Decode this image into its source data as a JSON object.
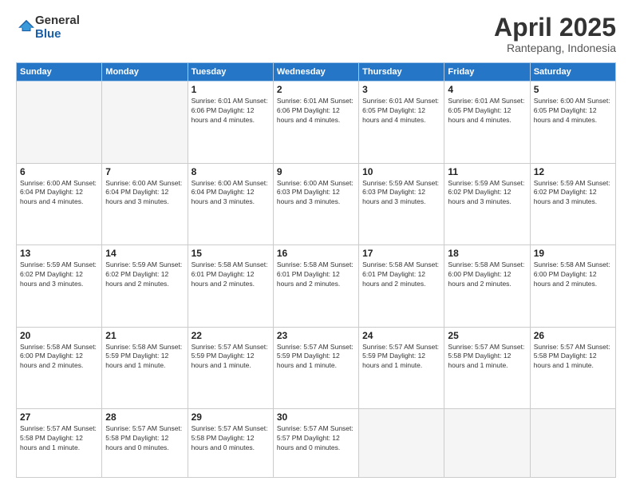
{
  "logo": {
    "general": "General",
    "blue": "Blue"
  },
  "title": {
    "month": "April 2025",
    "location": "Rantepang, Indonesia"
  },
  "days_of_week": [
    "Sunday",
    "Monday",
    "Tuesday",
    "Wednesday",
    "Thursday",
    "Friday",
    "Saturday"
  ],
  "weeks": [
    [
      {
        "day": "",
        "detail": ""
      },
      {
        "day": "",
        "detail": ""
      },
      {
        "day": "1",
        "detail": "Sunrise: 6:01 AM\nSunset: 6:06 PM\nDaylight: 12 hours and 4 minutes."
      },
      {
        "day": "2",
        "detail": "Sunrise: 6:01 AM\nSunset: 6:06 PM\nDaylight: 12 hours and 4 minutes."
      },
      {
        "day": "3",
        "detail": "Sunrise: 6:01 AM\nSunset: 6:05 PM\nDaylight: 12 hours and 4 minutes."
      },
      {
        "day": "4",
        "detail": "Sunrise: 6:01 AM\nSunset: 6:05 PM\nDaylight: 12 hours and 4 minutes."
      },
      {
        "day": "5",
        "detail": "Sunrise: 6:00 AM\nSunset: 6:05 PM\nDaylight: 12 hours and 4 minutes."
      }
    ],
    [
      {
        "day": "6",
        "detail": "Sunrise: 6:00 AM\nSunset: 6:04 PM\nDaylight: 12 hours and 4 minutes."
      },
      {
        "day": "7",
        "detail": "Sunrise: 6:00 AM\nSunset: 6:04 PM\nDaylight: 12 hours and 3 minutes."
      },
      {
        "day": "8",
        "detail": "Sunrise: 6:00 AM\nSunset: 6:04 PM\nDaylight: 12 hours and 3 minutes."
      },
      {
        "day": "9",
        "detail": "Sunrise: 6:00 AM\nSunset: 6:03 PM\nDaylight: 12 hours and 3 minutes."
      },
      {
        "day": "10",
        "detail": "Sunrise: 5:59 AM\nSunset: 6:03 PM\nDaylight: 12 hours and 3 minutes."
      },
      {
        "day": "11",
        "detail": "Sunrise: 5:59 AM\nSunset: 6:02 PM\nDaylight: 12 hours and 3 minutes."
      },
      {
        "day": "12",
        "detail": "Sunrise: 5:59 AM\nSunset: 6:02 PM\nDaylight: 12 hours and 3 minutes."
      }
    ],
    [
      {
        "day": "13",
        "detail": "Sunrise: 5:59 AM\nSunset: 6:02 PM\nDaylight: 12 hours and 3 minutes."
      },
      {
        "day": "14",
        "detail": "Sunrise: 5:59 AM\nSunset: 6:02 PM\nDaylight: 12 hours and 2 minutes."
      },
      {
        "day": "15",
        "detail": "Sunrise: 5:58 AM\nSunset: 6:01 PM\nDaylight: 12 hours and 2 minutes."
      },
      {
        "day": "16",
        "detail": "Sunrise: 5:58 AM\nSunset: 6:01 PM\nDaylight: 12 hours and 2 minutes."
      },
      {
        "day": "17",
        "detail": "Sunrise: 5:58 AM\nSunset: 6:01 PM\nDaylight: 12 hours and 2 minutes."
      },
      {
        "day": "18",
        "detail": "Sunrise: 5:58 AM\nSunset: 6:00 PM\nDaylight: 12 hours and 2 minutes."
      },
      {
        "day": "19",
        "detail": "Sunrise: 5:58 AM\nSunset: 6:00 PM\nDaylight: 12 hours and 2 minutes."
      }
    ],
    [
      {
        "day": "20",
        "detail": "Sunrise: 5:58 AM\nSunset: 6:00 PM\nDaylight: 12 hours and 2 minutes."
      },
      {
        "day": "21",
        "detail": "Sunrise: 5:58 AM\nSunset: 5:59 PM\nDaylight: 12 hours and 1 minute."
      },
      {
        "day": "22",
        "detail": "Sunrise: 5:57 AM\nSunset: 5:59 PM\nDaylight: 12 hours and 1 minute."
      },
      {
        "day": "23",
        "detail": "Sunrise: 5:57 AM\nSunset: 5:59 PM\nDaylight: 12 hours and 1 minute."
      },
      {
        "day": "24",
        "detail": "Sunrise: 5:57 AM\nSunset: 5:59 PM\nDaylight: 12 hours and 1 minute."
      },
      {
        "day": "25",
        "detail": "Sunrise: 5:57 AM\nSunset: 5:58 PM\nDaylight: 12 hours and 1 minute."
      },
      {
        "day": "26",
        "detail": "Sunrise: 5:57 AM\nSunset: 5:58 PM\nDaylight: 12 hours and 1 minute."
      }
    ],
    [
      {
        "day": "27",
        "detail": "Sunrise: 5:57 AM\nSunset: 5:58 PM\nDaylight: 12 hours and 1 minute."
      },
      {
        "day": "28",
        "detail": "Sunrise: 5:57 AM\nSunset: 5:58 PM\nDaylight: 12 hours and 0 minutes."
      },
      {
        "day": "29",
        "detail": "Sunrise: 5:57 AM\nSunset: 5:58 PM\nDaylight: 12 hours and 0 minutes."
      },
      {
        "day": "30",
        "detail": "Sunrise: 5:57 AM\nSunset: 5:57 PM\nDaylight: 12 hours and 0 minutes."
      },
      {
        "day": "",
        "detail": ""
      },
      {
        "day": "",
        "detail": ""
      },
      {
        "day": "",
        "detail": ""
      }
    ]
  ]
}
